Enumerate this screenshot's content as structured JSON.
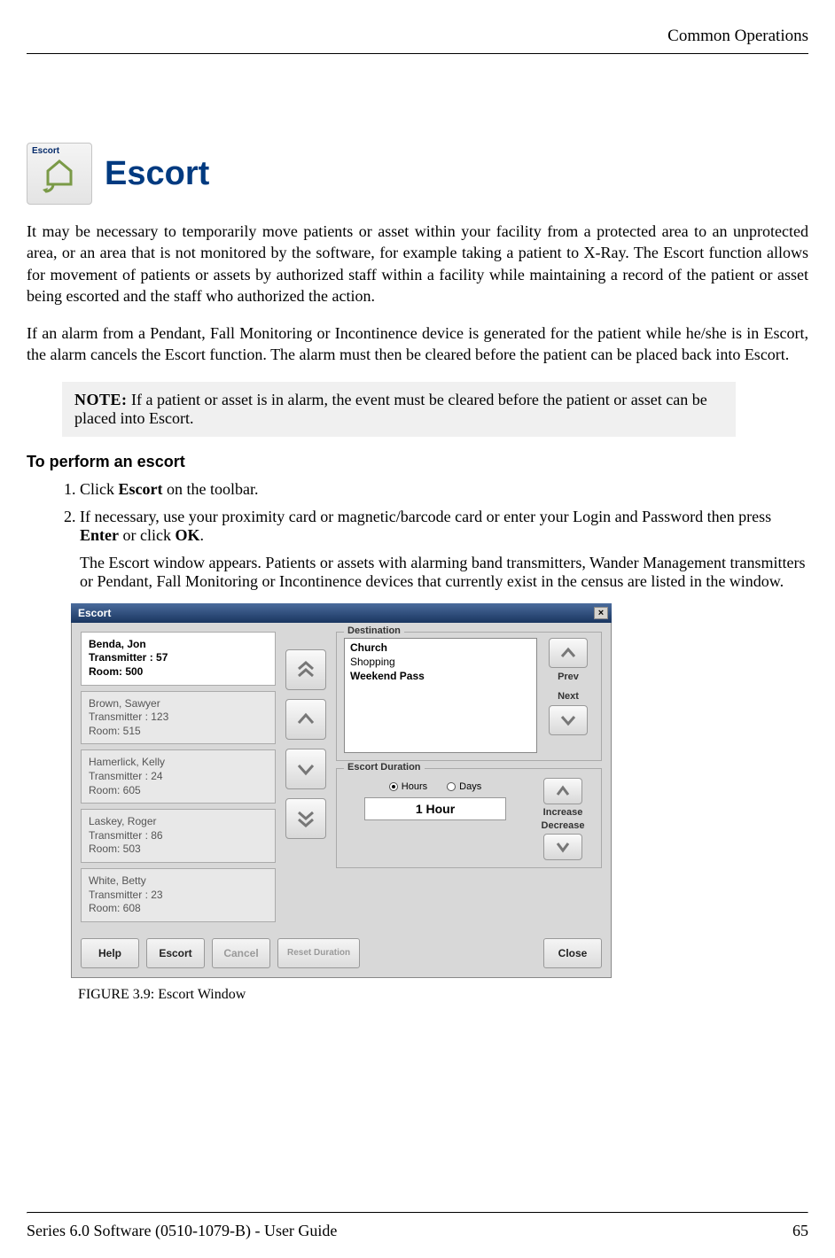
{
  "header": {
    "running_title": "Common Operations"
  },
  "section": {
    "icon_label": "Escort",
    "title": "Escort",
    "para1": "It may be necessary to temporarily move patients or asset within your facility from a protected area to an unprotected area, or an area that is not monitored by the software, for example taking a patient to X-Ray. The Escort function allows for movement of patients or assets by authorized staff within a facility while maintaining a record of the patient or asset being escorted and the staff who authorized the action.",
    "para2": "If an alarm from a Pendant, Fall Monitoring or Incontinence device is generated for the patient while he/she is in Escort, the alarm cancels the Escort function. The alarm must then be cleared before the patient can be placed back into Escort."
  },
  "note": {
    "label": "NOTE:",
    "text": " If a patient or asset is in alarm, the event must be cleared before the patient or asset can be placed into Escort."
  },
  "task": {
    "heading": "To perform an escort",
    "steps": [
      {
        "text_parts": [
          "Click ",
          "Escort",
          " on the toolbar."
        ],
        "bold_index": 1
      },
      {
        "text_parts": [
          "If necessary, use your proximity card or magnetic/barcode card or enter your Login and Password then press ",
          "Enter",
          " or click ",
          "OK",
          "."
        ],
        "extra": "The Escort window appears. Patients or assets with alarming band transmitters, Wander Management transmitters or Pendant, Fall Monitoring or Incontinence devices that currently exist in the census are listed in the window."
      }
    ]
  },
  "dialog": {
    "title": "Escort",
    "patients": [
      {
        "name": "Benda, Jon",
        "tx": "Transmitter : 57",
        "room": "Room: 500",
        "selected": true
      },
      {
        "name": "Brown, Sawyer",
        "tx": "Transmitter : 123",
        "room": "Room: 515",
        "selected": false
      },
      {
        "name": "Hamerlick, Kelly",
        "tx": "Transmitter : 24",
        "room": "Room: 605",
        "selected": false
      },
      {
        "name": "Laskey, Roger",
        "tx": "Transmitter : 86",
        "room": "Room: 503",
        "selected": false
      },
      {
        "name": "White, Betty",
        "tx": "Transmitter : 23",
        "room": "Room: 608",
        "selected": false
      }
    ],
    "destination": {
      "label": "Destination",
      "items": [
        "Church",
        "Shopping",
        "Weekend Pass"
      ],
      "prev": "Prev",
      "next": "Next"
    },
    "duration": {
      "label": "Escort Duration",
      "hours_label": "Hours",
      "days_label": "Days",
      "value": "1 Hour",
      "increase": "Increase",
      "decrease": "Decrease"
    },
    "buttons": {
      "help": "Help",
      "escort": "Escort",
      "cancel": "Cancel",
      "reset_duration": "Reset Duration",
      "close": "Close"
    }
  },
  "figure": {
    "caption": "FIGURE 3.9:    Escort Window"
  },
  "footer": {
    "left": "Series 6.0 Software (0510-1079-B) - User Guide",
    "page": "65"
  }
}
